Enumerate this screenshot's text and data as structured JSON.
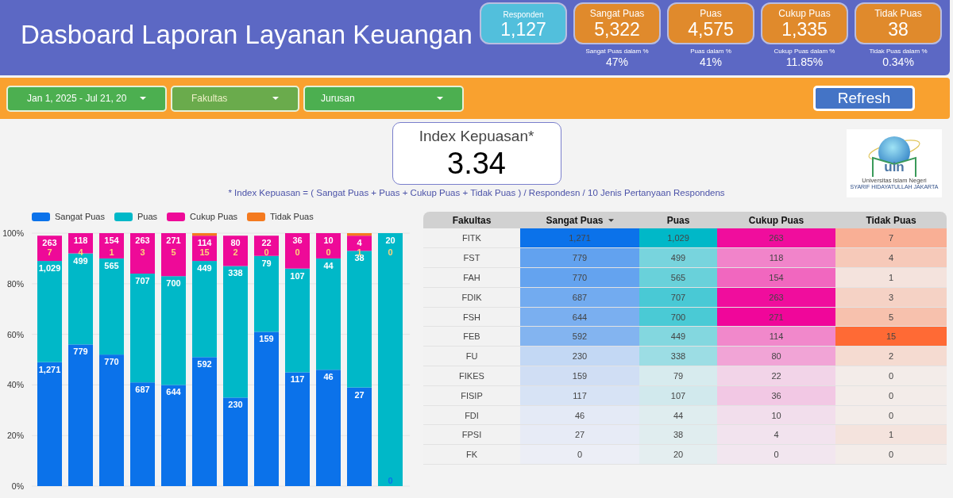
{
  "header": {
    "title": "Dasboard Laporan Layanan Keuangan",
    "kpis": [
      {
        "label": "Responden",
        "value": "1,127",
        "color": "#52bfdc"
      },
      {
        "label": "Sangat Puas",
        "value": "5,322",
        "color": "#e08a2c",
        "share_label": "Sangat Puas dalam %",
        "share": "47%"
      },
      {
        "label": "Puas",
        "value": "4,575",
        "color": "#e08a2c",
        "share_label": "Puas dalam %",
        "share": "41%"
      },
      {
        "label": "Cukup Puas",
        "value": "1,335",
        "color": "#e08a2c",
        "share_label": "Cukup Puas dalam %",
        "share": "11.85%"
      },
      {
        "label": "Tidak Puas",
        "value": "38",
        "color": "#e08a2c",
        "share_label": "Tidak Puas dalam %",
        "share": "0.34%"
      }
    ]
  },
  "filters": {
    "dropdowns": [
      {
        "value": "Jan 1, 2025 - Jul 21, 20",
        "color": "#4caf50"
      },
      {
        "value": "Fakultas",
        "color": "#6aab4c"
      },
      {
        "value": "Jurusan",
        "color": "#4caf50"
      }
    ],
    "refresh_button": "Refresh"
  },
  "index_card": {
    "label": "Index Kepuasan*",
    "value": "3.34"
  },
  "formula_note": "* Index Kepuasan = ( Sangat Puas + Puas + Cukup Puas + Tidak Puas ) / Respondesn / 10 Jenis Pertanyaan Respondens",
  "logo": {
    "mark": "uin",
    "subtitle": "Universitas Islam Negeri",
    "caption": "SYARIF HIDAYATULLAH JAKARTA"
  },
  "chart": {
    "chart_data": {
      "type": "bar",
      "stacked": true,
      "orientation": "vertical",
      "grid": true,
      "ylim": [
        0,
        1
      ],
      "yticks": [
        {
          "value": 0,
          "label": "0%"
        },
        {
          "value": 0.2,
          "label": "20%"
        },
        {
          "value": 0.4,
          "label": "40%"
        },
        {
          "value": 0.6,
          "label": "60%"
        },
        {
          "value": 0.8,
          "label": "80%"
        },
        {
          "value": 1,
          "label": "100%"
        }
      ],
      "series": [
        {
          "name": "Sangat Puas",
          "color": "#0b72ea",
          "values": [
            0.49,
            0.56,
            0.52,
            0.41,
            0.4,
            0.51,
            0.35,
            0.61,
            0.45,
            0.46,
            0.39,
            0
          ]
        },
        {
          "name": "Puas",
          "color": "#00b8c8",
          "values": [
            0.4,
            0.36,
            0.38,
            0.43,
            0.43,
            0.38,
            0.52,
            0.3,
            0.41,
            0.44,
            0.54,
            1
          ]
        },
        {
          "name": "Cukup Puas",
          "color": "#ee0a98",
          "values": [
            0.1,
            0.08,
            0.1,
            0.16,
            0.17,
            0.1,
            0.12,
            0.08,
            0.14,
            0.1,
            0.06,
            0
          ]
        },
        {
          "name": "Tidak Puas",
          "color": "#f47a1f",
          "values": [
            0,
            0,
            0,
            0,
            0,
            0.01,
            0,
            0,
            0,
            0,
            0.01,
            0
          ]
        }
      ]
    },
    "segment_labels": [
      {
        "cukup_puas": "263",
        "tidak_puas": "7",
        "puas": "1,029",
        "sangat_puas": "1,271"
      },
      {
        "cukup_puas": "118",
        "tidak_puas": "4",
        "puas": "499",
        "sangat_puas": "779"
      },
      {
        "cukup_puas": "154",
        "tidak_puas": "1",
        "puas": "565",
        "sangat_puas": "770"
      },
      {
        "cukup_puas": "263",
        "tidak_puas": "3",
        "puas": "707",
        "sangat_puas": "687"
      },
      {
        "cukup_puas": "271",
        "tidak_puas": "5",
        "puas": "700",
        "sangat_puas": "644"
      },
      {
        "cukup_puas": "114",
        "tidak_puas": "15",
        "puas": "449",
        "sangat_puas": "592"
      },
      {
        "cukup_puas": "80",
        "tidak_puas": "2",
        "puas": "338",
        "sangat_puas": "230"
      },
      {
        "cukup_puas": "22",
        "tidak_puas": "0",
        "puas": "79",
        "sangat_puas": "159"
      },
      {
        "cukup_puas": "36",
        "tidak_puas": "0",
        "puas": "107",
        "sangat_puas": "117"
      },
      {
        "cukup_puas": "10",
        "tidak_puas": "0",
        "puas": "44",
        "sangat_puas": "46"
      },
      {
        "cukup_puas": "4",
        "tidak_puas": "1",
        "puas": "38",
        "sangat_puas": "27"
      },
      {
        "puas": "20",
        "tidak_puas": "0",
        "sangat_puas": "0"
      }
    ]
  },
  "table": {
    "columns": [
      {
        "label": "Fakultas",
        "sorted": false
      },
      {
        "label": "Sangat Puas",
        "sorted": true,
        "color": "#0b72ea"
      },
      {
        "label": "Puas",
        "sorted": false,
        "color": "#00b8c8"
      },
      {
        "label": "Cukup Puas",
        "sorted": false,
        "color": "#f0069a"
      },
      {
        "label": "Tidak Puas",
        "sorted": false,
        "color": "#ff6a35"
      }
    ],
    "rows": [
      [
        "FITK",
        "1,271",
        "1,029",
        "263",
        "7"
      ],
      [
        "FST",
        "779",
        "499",
        "118",
        "4"
      ],
      [
        "FAH",
        "770",
        "565",
        "154",
        "1"
      ],
      [
        "FDIK",
        "687",
        "707",
        "263",
        "3"
      ],
      [
        "FSH",
        "644",
        "700",
        "271",
        "5"
      ],
      [
        "FEB",
        "592",
        "449",
        "114",
        "15"
      ],
      [
        "FU",
        "230",
        "338",
        "80",
        "2"
      ],
      [
        "FIKES",
        "159",
        "79",
        "22",
        "0"
      ],
      [
        "FISIP",
        "117",
        "107",
        "36",
        "0"
      ],
      [
        "FDI",
        "46",
        "44",
        "10",
        "0"
      ],
      [
        "FPSI",
        "27",
        "38",
        "4",
        "1"
      ],
      [
        "FK",
        "0",
        "20",
        "0",
        "0"
      ]
    ]
  }
}
